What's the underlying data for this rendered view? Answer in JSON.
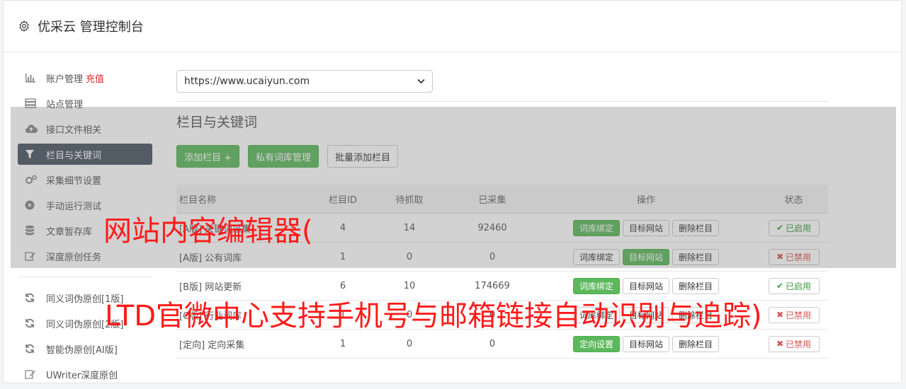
{
  "header": {
    "title": "优采云 管理控制台",
    "icon": "gear-icon"
  },
  "sidebar": {
    "items": [
      {
        "icon": "bar-chart-icon",
        "label": "账户管理",
        "extra": "充值"
      },
      {
        "icon": "server-icon",
        "label": "站点管理"
      },
      {
        "icon": "cloud-upload-icon",
        "label": "接口文件相关"
      },
      {
        "icon": "filter-icon",
        "label": "栏目与关键词",
        "active": true
      },
      {
        "icon": "cogs-icon",
        "label": "采集细节设置"
      },
      {
        "icon": "play-circle-icon",
        "label": "手动运行测试"
      },
      {
        "icon": "database-icon",
        "label": "文章暂存库"
      },
      {
        "icon": "edit-icon",
        "label": "深度原创任务"
      }
    ],
    "items2": [
      {
        "icon": "refresh-icon",
        "label": "同义词伪原创[1版]"
      },
      {
        "icon": "refresh-icon",
        "label": "同义词伪原创[2版]"
      },
      {
        "icon": "refresh-icon",
        "label": "智能伪原创[AI版]"
      },
      {
        "icon": "edit-icon",
        "label": "UWriter深度原创"
      }
    ]
  },
  "main": {
    "site_select": {
      "value": "https://www.ucaiyun.com"
    },
    "section_title": "栏目与关键词",
    "toolbar": {
      "add_label": "添加栏目 +",
      "private_label": "私有词库管理",
      "batch_label": "批量添加栏目"
    },
    "table": {
      "headers": [
        "栏目名称",
        "栏目ID",
        "待抓取",
        "已采集",
        "操作",
        "状态"
      ],
      "rows": [
        {
          "name": "[A版] 关键词采集",
          "id": "4",
          "pending": "14",
          "collected": "92460",
          "ops": [
            "词库绑定",
            "目标网站",
            "删除栏目"
          ],
          "status": "已启用"
        },
        {
          "name": "[A版] 公有词库",
          "id": "1",
          "pending": "0",
          "collected": "0",
          "ops": [
            "词库绑定",
            "目标网站",
            "删除栏目"
          ],
          "status": "已禁用"
        },
        {
          "name": "[B版] 网站更新",
          "id": "6",
          "pending": "10",
          "collected": "174669",
          "ops": [
            "词库绑定",
            "目标网站",
            "删除栏目"
          ],
          "status": "已启用"
        },
        {
          "name": "[C版] 行业词库",
          "id": "1",
          "pending": "0",
          "collected": "0",
          "ops": [
            "词库绑定",
            "目标网站",
            "删除栏目"
          ],
          "status": "已禁用"
        },
        {
          "name": "[定向] 定向采集",
          "id": "1",
          "pending": "0",
          "collected": "0",
          "ops": [
            "定向设置",
            "目标网站",
            "删除栏目"
          ],
          "status": "已禁用"
        }
      ]
    }
  },
  "watermark": {
    "line1": "网站内容编辑器(",
    "line2": "LTD官微中心支持手机号与邮箱链接自动识别与追踪)"
  },
  "colors": {
    "green": "#5cb85c",
    "active_nav": "#4a5563",
    "red": "#e02b2b",
    "watermark": "#ff1a1a"
  }
}
